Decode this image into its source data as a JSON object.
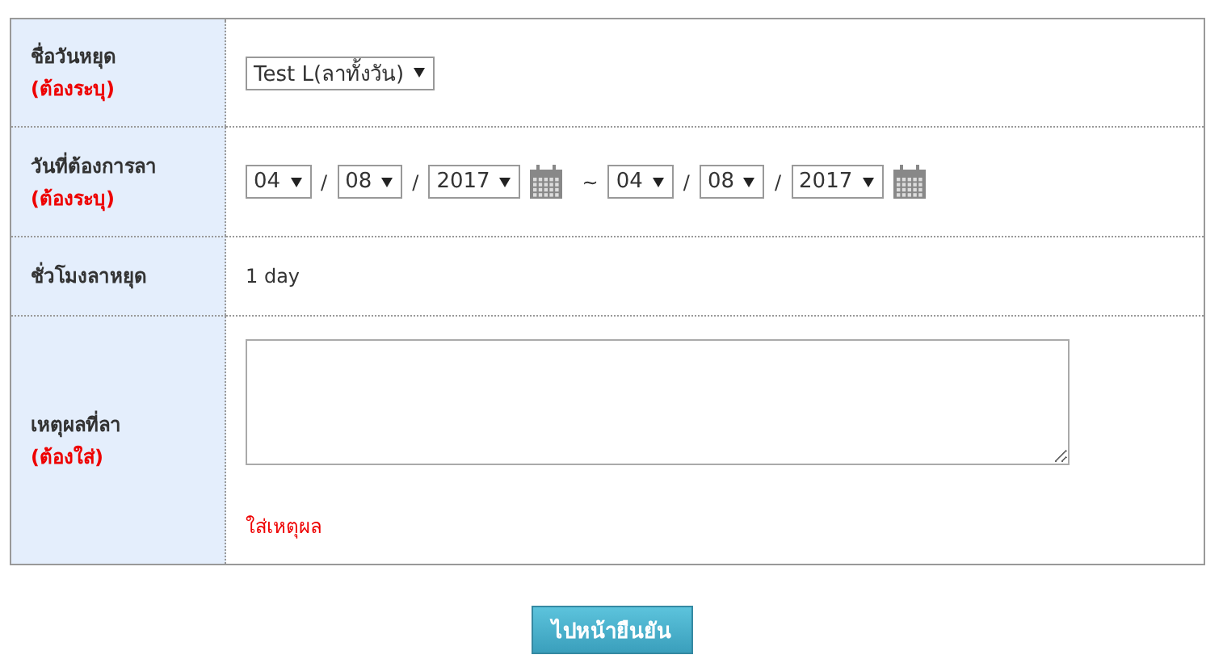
{
  "form": {
    "rows": [
      {
        "kind": "select",
        "label": "ชื่อวันหยุด",
        "required": "(ต้องระบุ)",
        "value": "Test L(ลาทั้งวัน)"
      },
      {
        "kind": "daterange",
        "label": "วันที่ต้องการลา",
        "required": "(ต้องระบุ)",
        "from": [
          "04",
          "08",
          "2017"
        ],
        "separators": [
          "/",
          "/"
        ],
        "range_separator": "~",
        "to": [
          "04",
          "08",
          "2017"
        ],
        "to_separators": [
          "/",
          "/"
        ]
      },
      {
        "kind": "text",
        "label": "ชั่วโมงลาหยุด",
        "value": "1 day"
      },
      {
        "kind": "textarea",
        "label": "เหตุผลที่ลา",
        "required": " (ต้องใส่)",
        "hint": "ใส่เหตุผล"
      }
    ]
  },
  "submit_button": "ไปหน้ายืนยัน"
}
